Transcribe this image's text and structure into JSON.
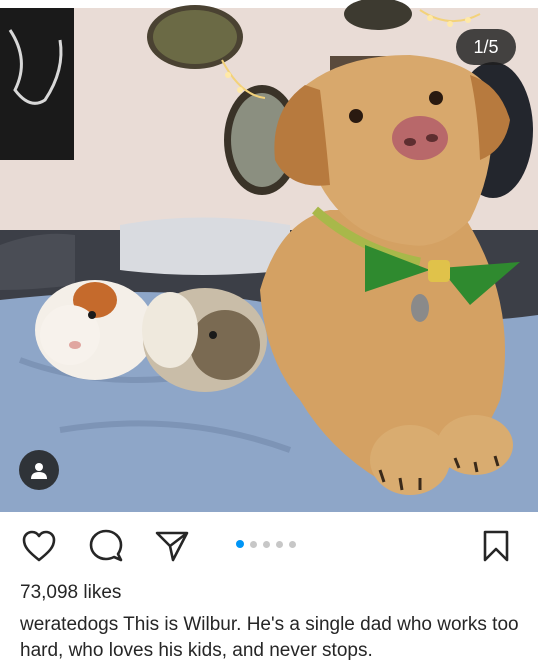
{
  "post": {
    "image_counter": "1/5",
    "image_index": 1,
    "image_total": 5,
    "image_description_icon": "photo",
    "likes": "73,098 likes",
    "username": "weratedogs",
    "caption_text": "This is Wilbur. He's a single dad who works too hard, who loves his kids, and never stops."
  },
  "icons": {
    "tag": "person-icon",
    "like": "heart-icon",
    "comment": "comment-bubble-icon",
    "share": "send-paper-plane-icon",
    "save": "bookmark-icon"
  },
  "colors": {
    "accent": "#0095f6",
    "inactive_dot": "#c7c7c7",
    "text": "#262626"
  }
}
